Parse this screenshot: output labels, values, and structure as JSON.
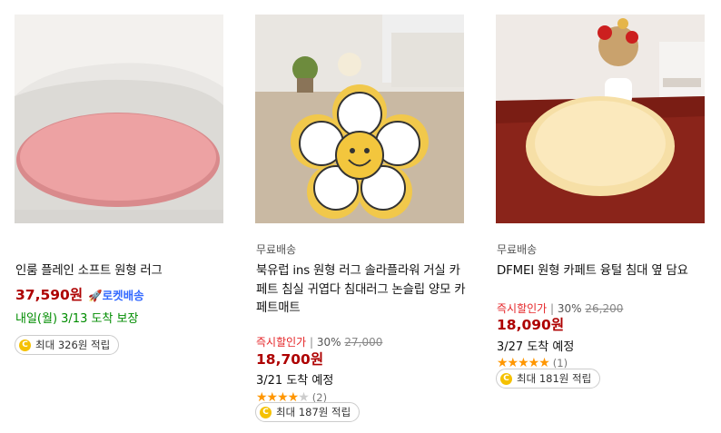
{
  "colors": {
    "price": "#ae0000",
    "rocket": "#346aff",
    "arrival_green": "#008c00",
    "discount_red": "#e52528",
    "star": "#ff9600",
    "coin": "#f5c100"
  },
  "products": [
    {
      "image_desc": "pink round rug",
      "title": "인룸 플레인 소프트 원형 러그",
      "price": "37,590원",
      "delivery_badge": "로켓배송",
      "arrival": "내일(월) 3/13 도착 보장",
      "points": "최대 326원 적립"
    },
    {
      "image_desc": "yellow daisy smiley rug",
      "shipping": "무료배송",
      "title": "북유럽 ins 원형 러그 솔라플라워 거실 카페트 침실 귀엽다 침대러그 논슬립 양모 카페트매트",
      "discount_label": "즉시할인가",
      "discount_pct": "30%",
      "orig_price": "27,000",
      "price": "18,700원",
      "arrival": "3/21 도착 예정",
      "rating": 4,
      "review_count": "(2)",
      "points": "최대 187원 적립"
    },
    {
      "image_desc": "cream fluffy round rug",
      "shipping": "무료배송",
      "title": "DFMEI 원형 카페트 융털 침대 옆 담요",
      "discount_label": "즉시할인가",
      "discount_pct": "30%",
      "orig_price": "26,200",
      "price": "18,090원",
      "arrival": "3/27 도착 예정",
      "rating": 5,
      "review_count": "(1)",
      "points": "최대 181원 적립"
    }
  ]
}
